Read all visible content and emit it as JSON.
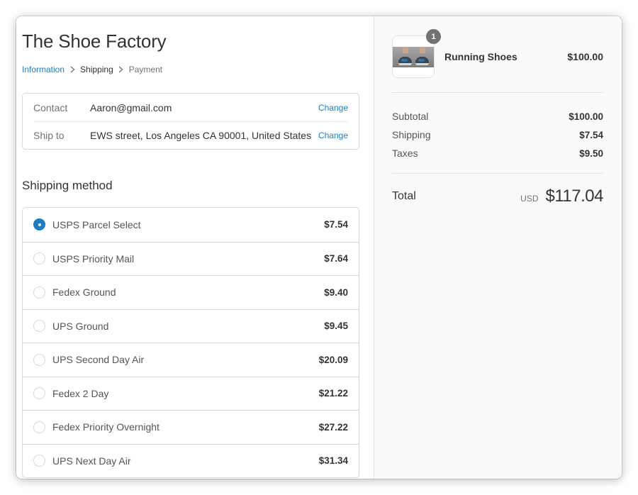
{
  "shop": {
    "title": "The Shoe Factory"
  },
  "breadcrumb": {
    "items": [
      {
        "label": "Information",
        "state": "completed"
      },
      {
        "label": "Shipping",
        "state": "current"
      },
      {
        "label": "Payment",
        "state": "upcoming"
      }
    ],
    "separator_icon": "chevron-right-icon"
  },
  "review": {
    "rows": [
      {
        "label": "Contact",
        "value": "Aaron@gmail.com",
        "action": "Change"
      },
      {
        "label": "Ship to",
        "value": "EWS street, Los Angeles CA 90001, United States",
        "action": "Change"
      }
    ]
  },
  "shipping": {
    "title": "Shipping method",
    "selected_index": 0,
    "methods": [
      {
        "name": "USPS Parcel Select",
        "price": "$7.54",
        "selected": true
      },
      {
        "name": "USPS Priority Mail",
        "price": "$7.64",
        "selected": false
      },
      {
        "name": "Fedex Ground",
        "price": "$9.40",
        "selected": false
      },
      {
        "name": "UPS Ground",
        "price": "$9.45",
        "selected": false
      },
      {
        "name": "UPS Second Day Air",
        "price": "$20.09",
        "selected": false
      },
      {
        "name": "Fedex 2 Day",
        "price": "$21.22",
        "selected": false
      },
      {
        "name": "Fedex Priority Overnight",
        "price": "$27.22",
        "selected": false
      },
      {
        "name": "UPS Next Day Air",
        "price": "$31.34",
        "selected": false
      }
    ]
  },
  "order": {
    "product": {
      "name": "Running Shoes",
      "price": "$100.00",
      "quantity": "1",
      "image": "running-shoes-thumbnail"
    },
    "lines": [
      {
        "label": "Subtotal",
        "value": "$100.00"
      },
      {
        "label": "Shipping",
        "value": "$7.54"
      },
      {
        "label": "Taxes",
        "value": "$9.50"
      }
    ],
    "total": {
      "label": "Total",
      "currency": "USD",
      "value": "$117.04"
    }
  },
  "colors": {
    "accent": "#1f7dc2",
    "text": "#333333",
    "muted": "#737373",
    "border": "#d9d9d9",
    "sidebar_bg": "#fafafa"
  }
}
